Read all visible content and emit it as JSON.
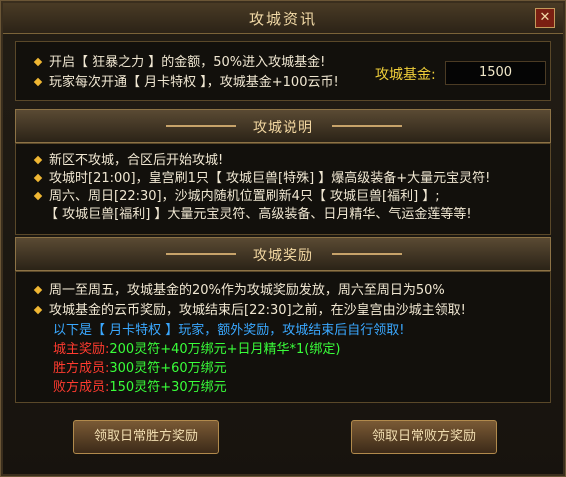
{
  "window": {
    "title": "攻城资讯"
  },
  "top": {
    "lines": [
      "开启【 狂暴之力 】的金额，50%进入攻城基金!",
      "玩家每次开通【 月卡特权 】，攻城基金+100云币!"
    ],
    "fund_label": "攻城基金:",
    "fund_value": "1500"
  },
  "section1": {
    "title": "攻城说明",
    "lines": [
      "新区不攻城，合区后开始攻城!",
      "攻城时[21:00]，皇宫刷1只【 攻城巨兽[特殊] 】爆高级装备+大量元宝灵符!",
      "周六、周日[22:30]，沙城内随机位置刷新4只【 攻城巨兽[福利] 】;",
      "【 攻城巨兽[福利] 】大量元宝灵符、高级装备、日月精华、气运金莲等等!"
    ]
  },
  "section2": {
    "title": "攻城奖励",
    "lines": [
      "周一至周五，攻城基金的20%作为攻城奖励发放，周六至周日为50%",
      "攻城基金的云币奖励，攻城结束后[22:30]之前，在沙皇宫由沙城主领取!"
    ],
    "vip_line": "以下是【 月卡特权 】玩家，额外奖励，攻城结束后自行领取!",
    "rewards": [
      {
        "label": "城主奖励:",
        "value": "200灵符+40万绑元+日月精华*1(绑定)"
      },
      {
        "label": "胜方成员:",
        "value": "300灵符+60万绑元"
      },
      {
        "label": "败方成员:",
        "value": "150灵符+30万绑元"
      }
    ]
  },
  "buttons": {
    "win": "领取日常胜方奖励",
    "lose": "领取日常败方奖励"
  }
}
